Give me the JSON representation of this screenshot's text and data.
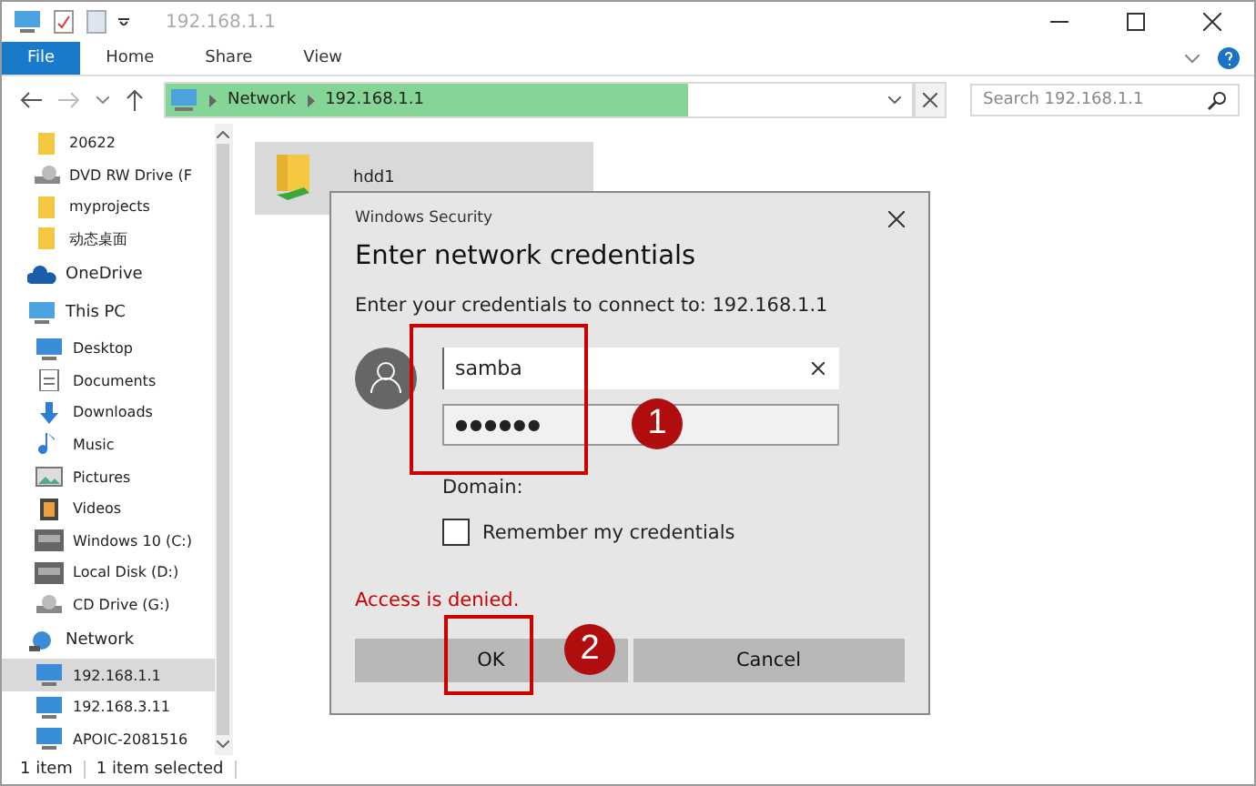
{
  "window": {
    "title": "192.168.1.1"
  },
  "ribbon": {
    "tabs": [
      {
        "label": "File",
        "selected": true
      },
      {
        "label": "Home",
        "selected": false
      },
      {
        "label": "Share",
        "selected": false
      },
      {
        "label": "View",
        "selected": false
      }
    ]
  },
  "address": {
    "crumbs": [
      "Network",
      "192.168.1.1"
    ],
    "level": 0.7
  },
  "search": {
    "placeholder": "Search 192.168.1.1"
  },
  "sidebar": {
    "quick_items": [
      {
        "label": "20622",
        "kind": "folder",
        "selected": false
      },
      {
        "label": "DVD RW Drive (F",
        "kind": "cd",
        "selected": false
      },
      {
        "label": "myprojects",
        "kind": "folder",
        "selected": false
      },
      {
        "label": "动态桌面",
        "kind": "folder",
        "selected": false
      }
    ],
    "items": [
      {
        "label": "OneDrive",
        "kind": "cloud",
        "selected": false
      },
      {
        "label": "This PC",
        "kind": "pc",
        "selected": false,
        "children": [
          {
            "label": "Desktop",
            "kind": "desktop",
            "selected": false
          },
          {
            "label": "Documents",
            "kind": "doc",
            "selected": false
          },
          {
            "label": "Downloads",
            "kind": "download",
            "selected": false
          },
          {
            "label": "Music",
            "kind": "music",
            "selected": false
          },
          {
            "label": "Pictures",
            "kind": "picture",
            "selected": false
          },
          {
            "label": "Videos",
            "kind": "video",
            "selected": false
          },
          {
            "label": "Windows 10 (C:)",
            "kind": "disk",
            "selected": false
          },
          {
            "label": "Local Disk (D:)",
            "kind": "disk",
            "selected": false
          },
          {
            "label": "CD Drive (G:)",
            "kind": "cd",
            "selected": false
          }
        ]
      },
      {
        "label": "Network",
        "kind": "network",
        "selected": false,
        "children": [
          {
            "label": "192.168.1.1",
            "kind": "pc",
            "selected": true
          },
          {
            "label": "192.168.3.11",
            "kind": "pc",
            "selected": false
          },
          {
            "label": "APOIC-2081516",
            "kind": "pc",
            "selected": false
          }
        ]
      }
    ]
  },
  "content": {
    "items": [
      {
        "label": "hdd1",
        "selected": true
      }
    ]
  },
  "status_bar": [
    "1 item",
    "1 item selected"
  ],
  "dialog": {
    "title": "Windows Security",
    "heading": "Enter network credentials",
    "prompt": "Enter your credentials to connect to: 192.168.1.1",
    "username": "samba",
    "password": "●●●●●●",
    "domain_label": "Domain:",
    "remember": {
      "label": "Remember my credentials",
      "checked": false
    },
    "error": "Access is denied.",
    "buttons": [
      "OK",
      "Cancel"
    ]
  },
  "annotations": [
    "1",
    "2"
  ]
}
